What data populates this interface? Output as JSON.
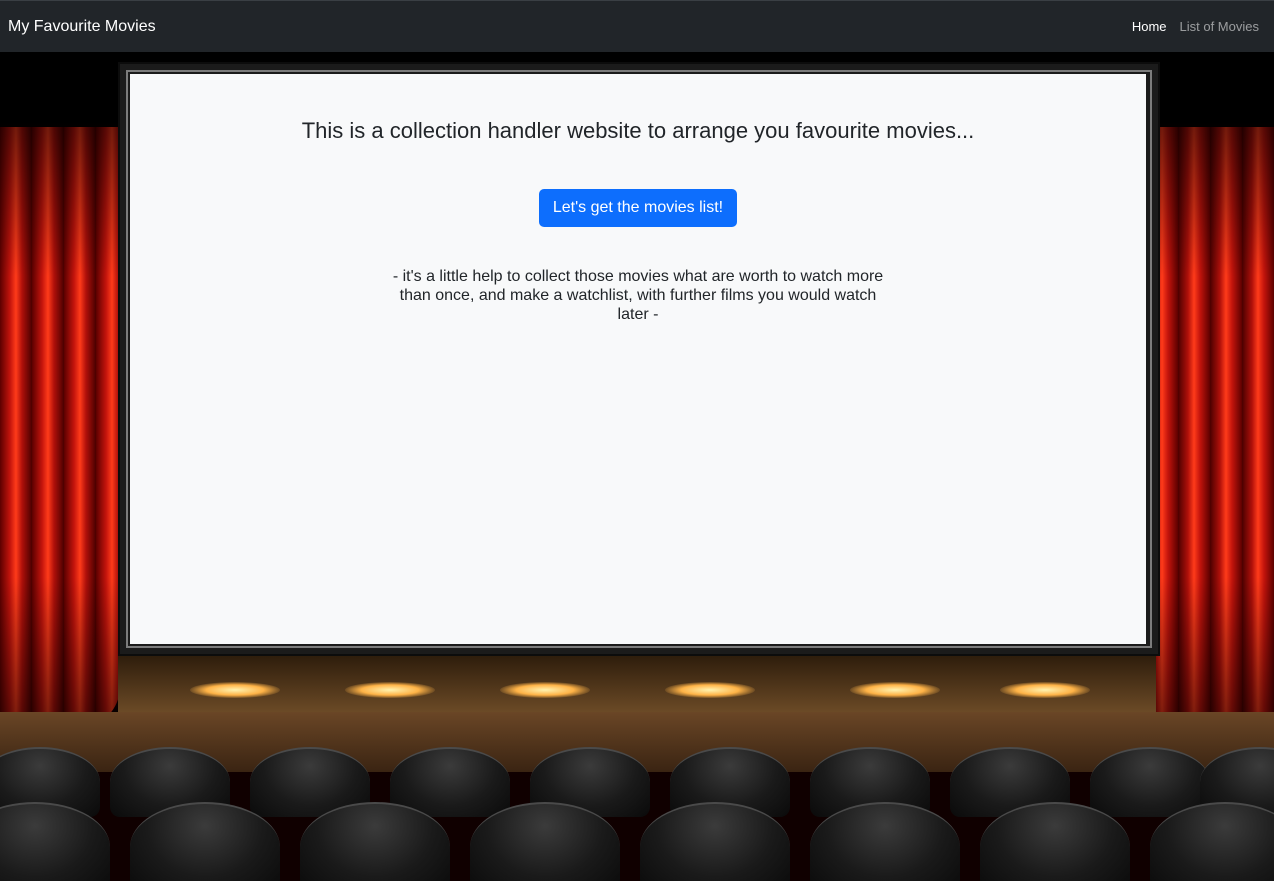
{
  "navbar": {
    "brand": "My Favourite Movies",
    "links": [
      {
        "label": "Home",
        "active": true
      },
      {
        "label": "List of Movies",
        "active": false
      }
    ]
  },
  "screen": {
    "heading": "This is a collection handler website to arrange you favourite movies...",
    "button_label": "Let's get the movies list!",
    "description": "- it's a little help to collect those movies what are worth to watch more than once, and make a watchlist, with further films you would watch later -"
  },
  "colors": {
    "navbar_bg": "#212529",
    "button_bg": "#0d6efd",
    "screen_bg": "#f8f9fa",
    "curtain": "#c3140c"
  }
}
